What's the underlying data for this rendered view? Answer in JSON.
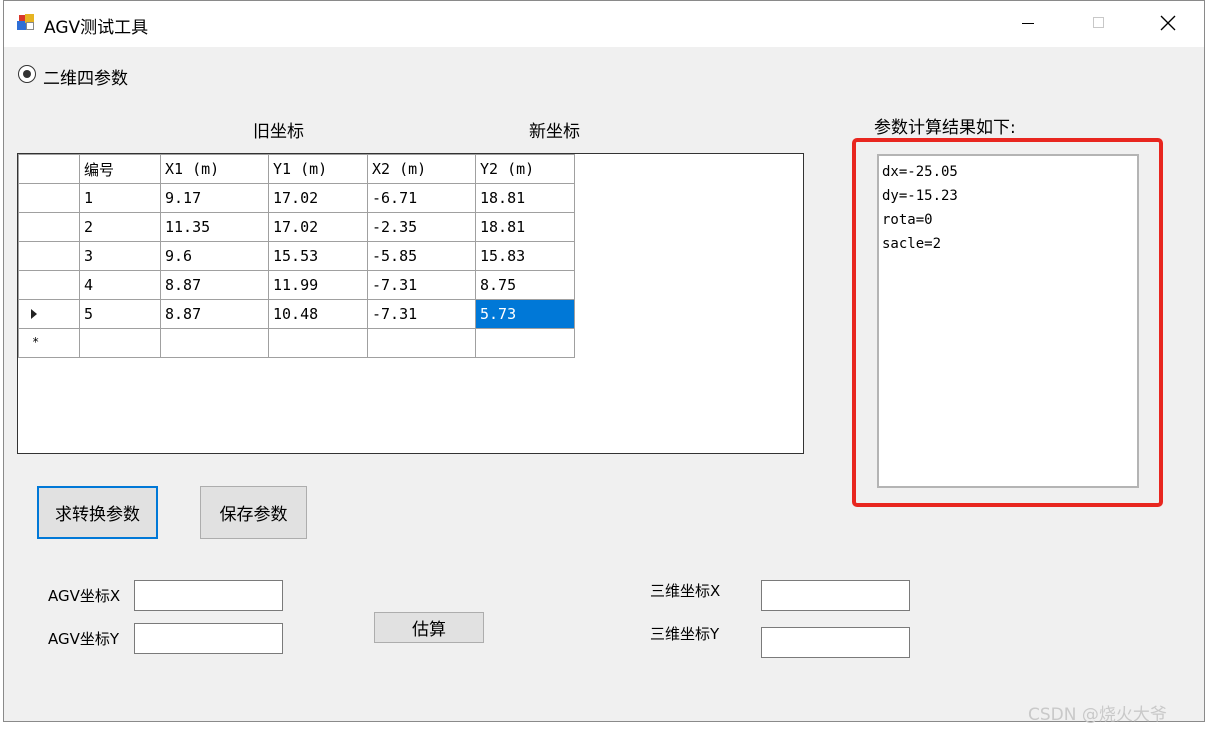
{
  "window": {
    "title": "AGV测试工具"
  },
  "mode": {
    "radio_label": "二维四参数"
  },
  "grid": {
    "old_header": "旧坐标",
    "new_header": "新坐标",
    "columns": [
      "编号",
      "X1 (m)",
      "Y1 (m)",
      "X2 (m)",
      "Y2 (m)"
    ],
    "rows": [
      [
        "1",
        "9.17",
        "17.02",
        "-6.71",
        "18.81"
      ],
      [
        "2",
        "11.35",
        "17.02",
        "-2.35",
        "18.81"
      ],
      [
        "3",
        "9.6",
        "15.53",
        "-5.85",
        "15.83"
      ],
      [
        "4",
        "8.87",
        "11.99",
        "-7.31",
        "8.75"
      ],
      [
        "5",
        "8.87",
        "10.48",
        "-7.31",
        "5.73"
      ]
    ],
    "new_row_marker": "*"
  },
  "results": {
    "label": "参数计算结果如下:",
    "lines": [
      "dx=-25.05",
      "dy=-15.23",
      "rota=0",
      "sacle=2"
    ]
  },
  "buttons": {
    "compute": "求转换参数",
    "save": "保存参数",
    "estimate": "估算"
  },
  "inputs": {
    "agv_x_label": "AGV坐标X",
    "agv_y_label": "AGV坐标Y",
    "three_x_label": "三维坐标X",
    "three_y_label": "三维坐标Y",
    "agv_x": "",
    "agv_y": "",
    "three_x": "",
    "three_y": ""
  },
  "watermark": "CSDN @烧火大爷",
  "colors": {
    "accent": "#0078d7",
    "highlight_frame": "#e8261f"
  }
}
